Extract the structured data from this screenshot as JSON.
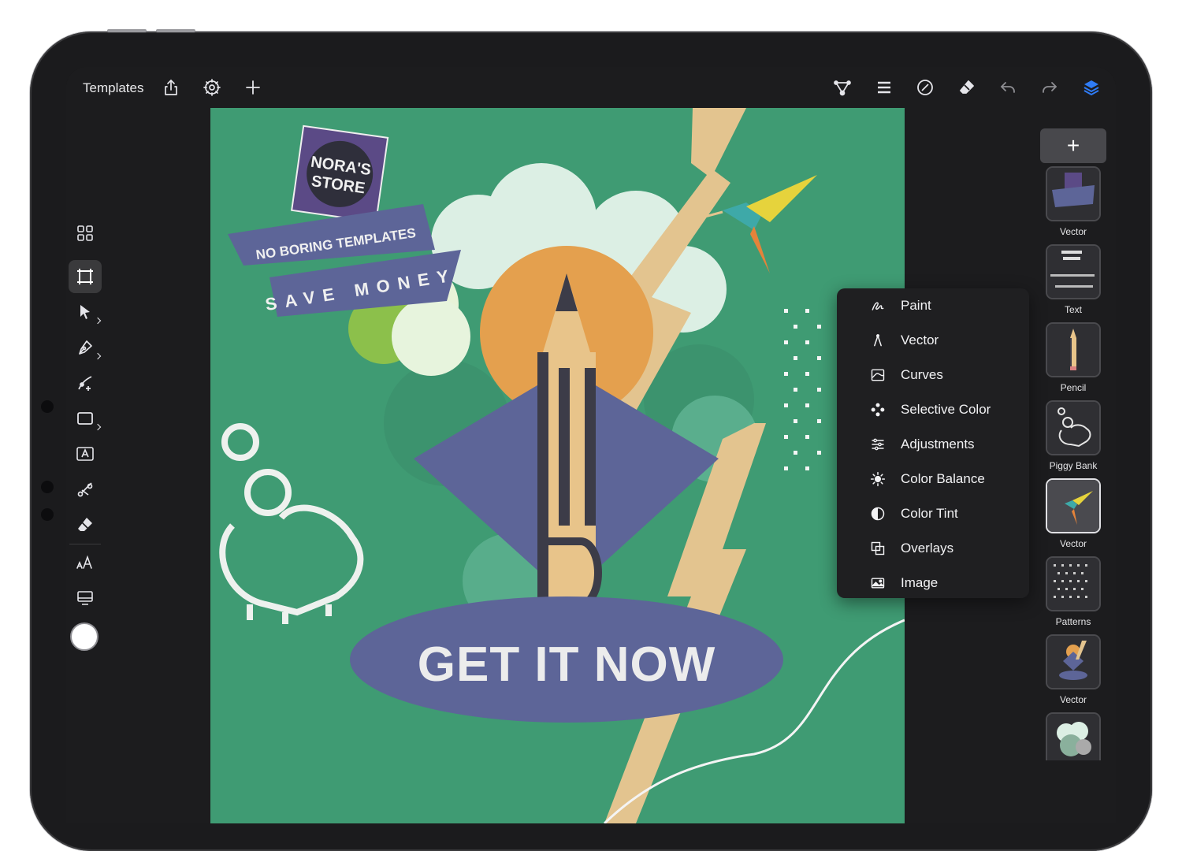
{
  "app": {
    "templates_label": "Templates"
  },
  "colors": {
    "accent": "#2f7cf6",
    "canvas_green": "#3f9b73",
    "ui_dark": "#1c1c1e"
  },
  "toolbar": {
    "left_icons": [
      "share-icon",
      "settings-icon",
      "plus-icon"
    ],
    "right_icons": [
      "node-icon",
      "menu-icon",
      "no-entry-icon",
      "eraser-icon",
      "undo-icon",
      "redo-icon",
      "layers-icon"
    ]
  },
  "tools": [
    "grid-icon",
    "crop-icon",
    "pointer-icon",
    "pen-icon",
    "node-add-icon",
    "rectangle-icon",
    "text-frame-icon",
    "scissors-icon",
    "eraser-icon",
    "font-size-icon",
    "screen-icon"
  ],
  "artwork": {
    "badge_line1": "NORA'S",
    "badge_line2": "STORE",
    "ribbon1": "NO BORING TEMPLATES",
    "ribbon2": "SAVE MONEY",
    "cta": "GET IT NOW"
  },
  "menu": {
    "items": [
      {
        "label": "Paint",
        "icon": "brush-icon"
      },
      {
        "label": "Vector",
        "icon": "pen-nib-icon"
      },
      {
        "label": "Curves",
        "icon": "curves-icon"
      },
      {
        "label": "Selective Color",
        "icon": "selective-color-icon"
      },
      {
        "label": "Adjustments",
        "icon": "sliders-icon"
      },
      {
        "label": "Color Balance",
        "icon": "sun-icon"
      },
      {
        "label": "Color Tint",
        "icon": "half-circle-icon"
      },
      {
        "label": "Overlays",
        "icon": "overlays-icon"
      },
      {
        "label": "Image",
        "icon": "image-icon"
      }
    ]
  },
  "layers": {
    "add_label": "+",
    "items": [
      {
        "label": "Vector"
      },
      {
        "label": "Text"
      },
      {
        "label": "Pencil"
      },
      {
        "label": "Piggy Bank"
      },
      {
        "label": "Vector"
      },
      {
        "label": "Patterns"
      },
      {
        "label": "Vector"
      }
    ]
  }
}
